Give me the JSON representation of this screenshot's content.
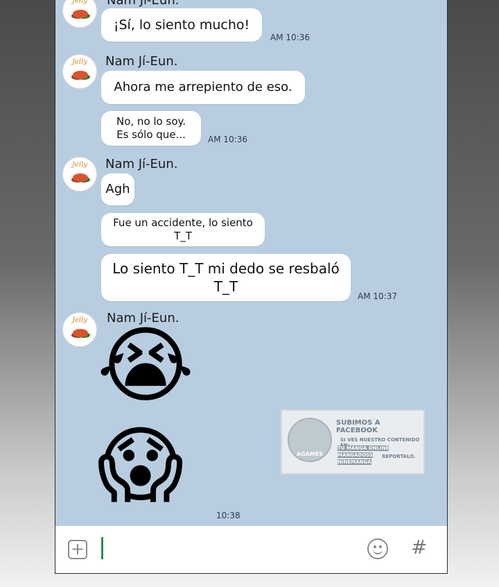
{
  "chat": {
    "sender_name_partial": "Nam Ji-Eun.",
    "sender_name": "Nam Jí-Eun.",
    "avatar_label": "Jelly",
    "messages": [
      {
        "text": "¡Sí, lo siento mucho!",
        "time": "AM 10:36"
      },
      {
        "text": "Ahora me arrepiento de eso."
      },
      {
        "text_line1": "No, no lo soy.",
        "text_line2": "Es sólo que...",
        "time": "AM 10:36"
      },
      {
        "text": "Agh"
      },
      {
        "text_line1": "Fue un accidente, lo siento",
        "text_line2": "T_T"
      },
      {
        "text_line1": "Lo siento T_T mi dedo se resbaló",
        "text_line2": "T_T",
        "time": "AM 10:37"
      },
      {
        "emoji": "😭"
      },
      {
        "emoji": "😱",
        "time": "10:38"
      }
    ]
  },
  "watermark": {
    "line1": "SUBIMOS A FACEBOOK",
    "line2": "SI VES NUESTRO CONTENIDO EN:",
    "line3": "TU MANGA ONLINE",
    "line4": "MANGADOSS",
    "line5": "NINEMANGA",
    "line6": "REPORTALO.",
    "circle_label": "AGAMES"
  },
  "input_bar": {
    "icons": [
      "add-icon",
      "emoji-icon",
      "hashtag-icon"
    ]
  }
}
